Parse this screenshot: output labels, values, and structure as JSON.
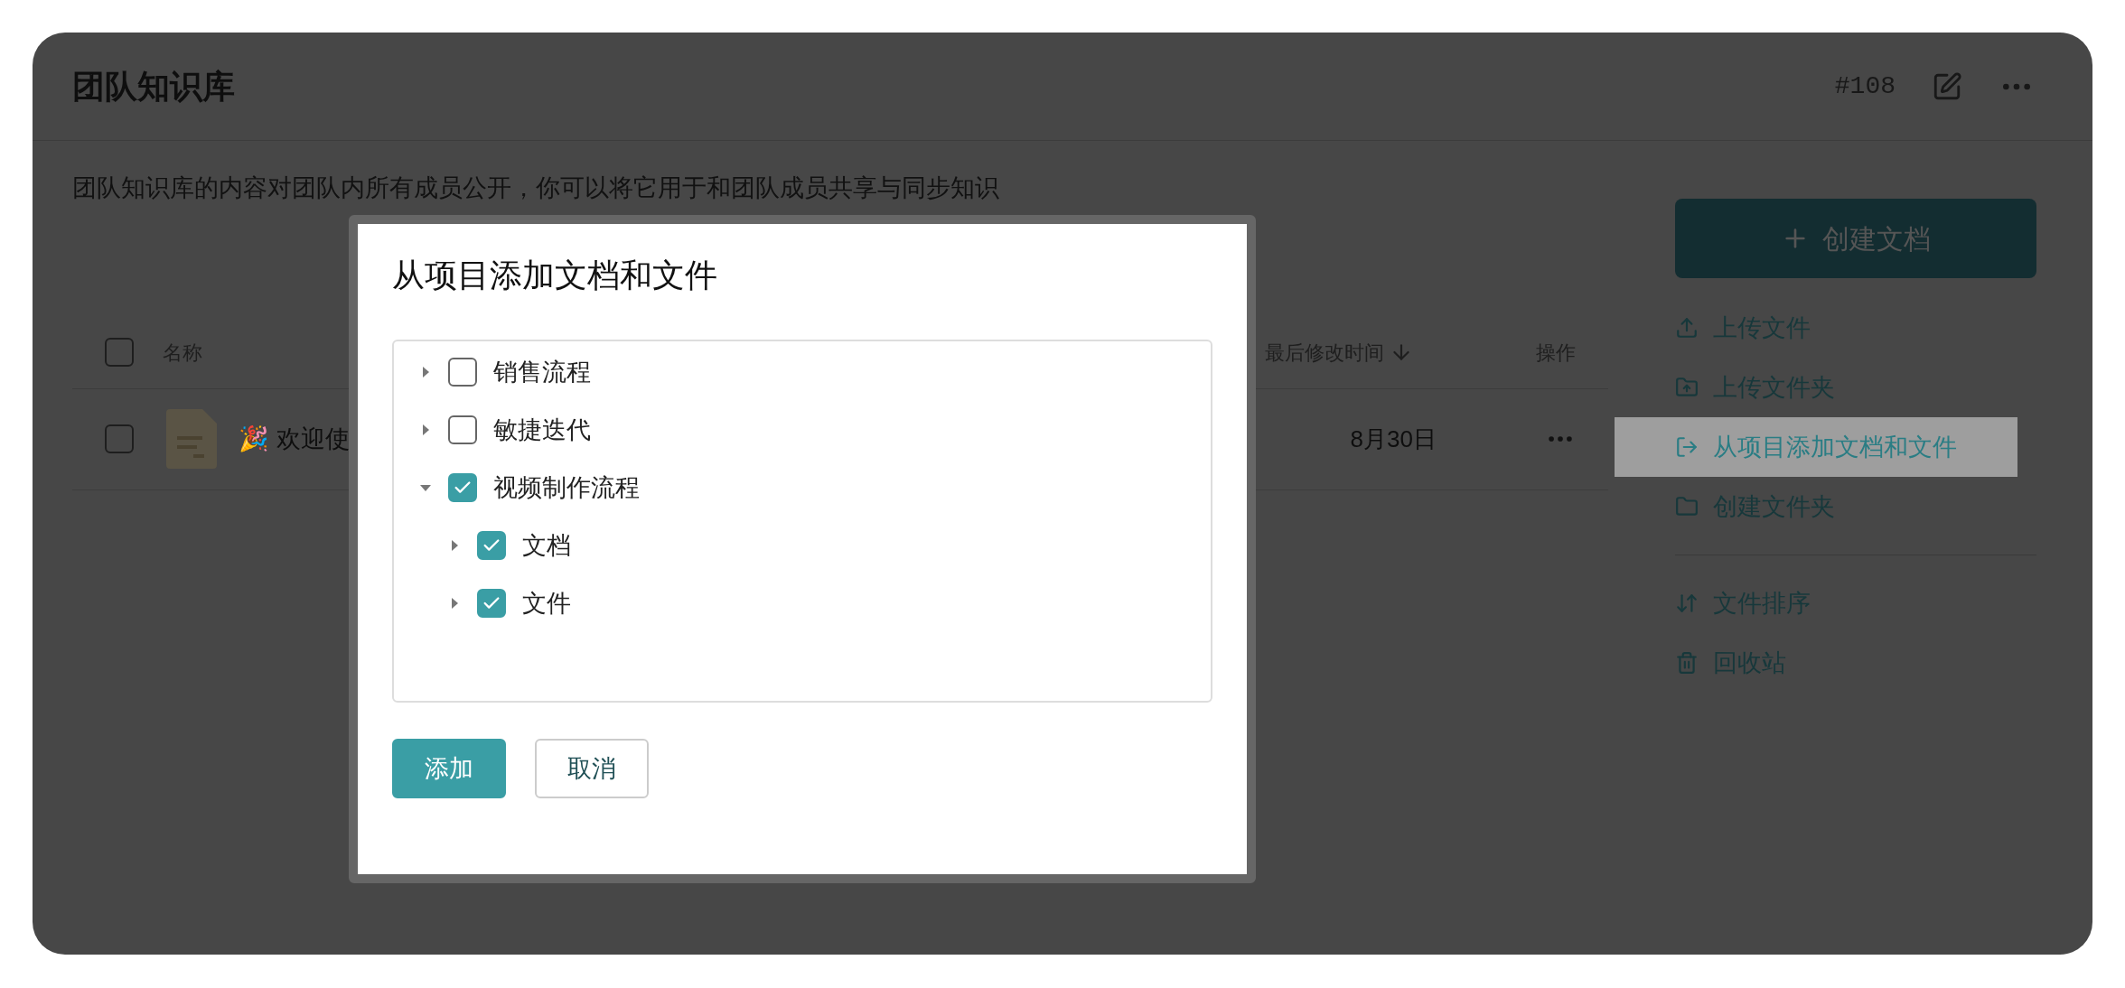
{
  "header": {
    "title": "团队知识库",
    "number": "#108"
  },
  "description": "团队知识库的内容对团队内所有成员公开，你可以将它用于和团队成员共享与同步知识",
  "table": {
    "select_all": {
      "checked": false
    },
    "columns": [
      {
        "label": "名称"
      },
      {
        "label": "最后修改时间",
        "sorted": true
      },
      {
        "label": "操作"
      }
    ],
    "rows": [
      {
        "checked": false,
        "name": "🎉 欢迎使",
        "modified": "8月30日"
      }
    ]
  },
  "sidebar": {
    "create_button": "创建文档",
    "actions": [
      {
        "label": "上传文件",
        "selected": false
      },
      {
        "label": "上传文件夹",
        "selected": false
      },
      {
        "label": "从项目添加文档和文件",
        "selected": true
      },
      {
        "label": "创建文件夹",
        "selected": false
      }
    ],
    "tools": [
      {
        "label": "文件排序"
      },
      {
        "label": "回收站"
      }
    ]
  },
  "dialog": {
    "title": "从项目添加文档和文件",
    "tree": [
      {
        "label": "销售流程",
        "checked": false,
        "expanded": false
      },
      {
        "label": "敏捷迭代",
        "checked": false,
        "expanded": false
      },
      {
        "label": "视频制作流程",
        "checked": true,
        "expanded": true,
        "children": [
          {
            "label": "文档",
            "checked": true,
            "expanded": false
          },
          {
            "label": "文件",
            "checked": true,
            "expanded": false
          }
        ]
      }
    ],
    "buttons": [
      {
        "label": "添加",
        "kind": "primary"
      },
      {
        "label": "取消",
        "kind": "secondary"
      }
    ]
  }
}
